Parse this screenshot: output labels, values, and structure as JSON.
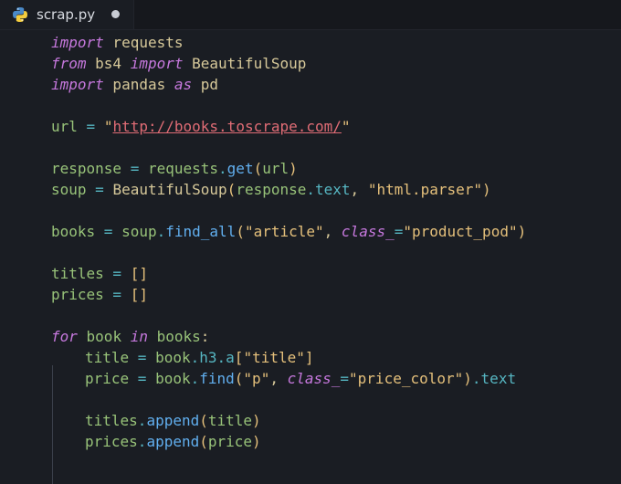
{
  "tab": {
    "filename": "scrap.py",
    "icon": "python-icon",
    "modified": true
  },
  "code": {
    "l1": [
      "import",
      " requests"
    ],
    "l2": [
      "from",
      " bs4 ",
      "import",
      " BeautifulSoup"
    ],
    "l3": [
      "import",
      " pandas ",
      "as",
      " pd"
    ],
    "l5": [
      "url",
      " = ",
      "\"",
      "http://books.toscrape.com/",
      "\""
    ],
    "l7": [
      "response",
      " = ",
      "requests",
      ".",
      "get",
      "(",
      "url",
      ")"
    ],
    "l8": [
      "soup",
      " = ",
      "BeautifulSoup",
      "(",
      "response",
      ".",
      "text",
      ", ",
      "\"html.parser\"",
      ")"
    ],
    "l10": [
      "books",
      " = ",
      "soup",
      ".",
      "find_all",
      "(",
      "\"article\"",
      ", ",
      "class_",
      "=",
      "\"product_pod\"",
      ")"
    ],
    "l12": [
      "titles",
      " = ",
      "[]"
    ],
    "l13": [
      "prices",
      " = ",
      "[]"
    ],
    "l15": [
      "for",
      " book ",
      "in",
      " books",
      ":"
    ],
    "l16": [
      "title",
      " = ",
      "book",
      ".",
      "h3",
      ".",
      "a",
      "[",
      "\"title\"",
      "]"
    ],
    "l17": [
      "price",
      " = ",
      "book",
      ".",
      "find",
      "(",
      "\"p\"",
      ", ",
      "class_",
      "=",
      "\"price_color\"",
      ")",
      ".",
      "text"
    ],
    "l19": [
      "titles",
      ".",
      "append",
      "(",
      "title",
      ")"
    ],
    "l20": [
      "prices",
      ".",
      "append",
      "(",
      "price",
      ")"
    ]
  }
}
